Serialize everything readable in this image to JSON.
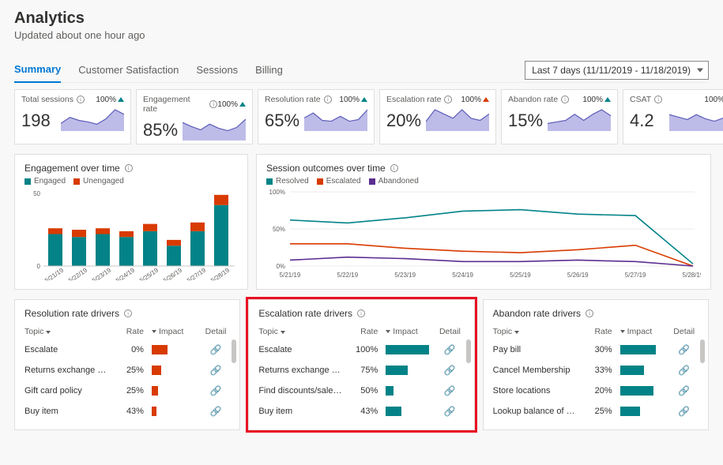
{
  "header": {
    "title": "Analytics",
    "subtitle": "Updated about one hour ago"
  },
  "tabs": [
    "Summary",
    "Customer Satisfaction",
    "Sessions",
    "Billing"
  ],
  "date_range": "Last 7 days (11/11/2019 - 11/18/2019)",
  "kpis": [
    {
      "label": "Total sessions",
      "value": "198",
      "pct": "100%",
      "trend": "up",
      "trend_color": "teal"
    },
    {
      "label": "Engagement rate",
      "value": "85%",
      "pct": "100%",
      "trend": "up",
      "trend_color": "teal"
    },
    {
      "label": "Resolution rate",
      "value": "65%",
      "pct": "100%",
      "trend": "up",
      "trend_color": "teal"
    },
    {
      "label": "Escalation rate",
      "value": "20%",
      "pct": "100%",
      "trend": "up",
      "trend_color": "orange"
    },
    {
      "label": "Abandon rate",
      "value": "15%",
      "pct": "100%",
      "trend": "up",
      "trend_color": "teal"
    },
    {
      "label": "CSAT",
      "value": "4.2",
      "pct": "100%",
      "trend": "up",
      "trend_color": "teal"
    }
  ],
  "engagement_card": {
    "title": "Engagement over time",
    "legend": [
      {
        "label": "Engaged",
        "color": "#038387"
      },
      {
        "label": "Unengaged",
        "color": "#d83b01"
      }
    ]
  },
  "outcomes_card": {
    "title": "Session outcomes over time",
    "legend": [
      {
        "label": "Resolved",
        "color": "#038387"
      },
      {
        "label": "Escalated",
        "color": "#d83b01"
      },
      {
        "label": "Abandoned",
        "color": "#5c2d91"
      }
    ]
  },
  "driver_cards": [
    {
      "title": "Resolution rate drivers",
      "head": {
        "topic": "Topic",
        "rate": "Rate",
        "impact": "Impact",
        "detail": "Detail"
      },
      "rows": [
        {
          "topic": "Escalate",
          "rate": "0%",
          "impact": 20,
          "color": "#d83b01"
        },
        {
          "topic": "Returns exchange and re...",
          "rate": "25%",
          "impact": 12,
          "color": "#d83b01"
        },
        {
          "topic": "Gift card policy",
          "rate": "25%",
          "impact": 8,
          "color": "#d83b01"
        },
        {
          "topic": "Buy item",
          "rate": "43%",
          "impact": 6,
          "color": "#d83b01"
        }
      ]
    },
    {
      "title": "Escalation rate drivers",
      "head": {
        "topic": "Topic",
        "rate": "Rate",
        "impact": "Impact",
        "detail": "Detail"
      },
      "rows": [
        {
          "topic": "Escalate",
          "rate": "100%",
          "impact": 55,
          "color": "#038387"
        },
        {
          "topic": "Returns exchange and r...",
          "rate": "75%",
          "impact": 28,
          "color": "#038387"
        },
        {
          "topic": "Find discounts/sales/de...",
          "rate": "50%",
          "impact": 10,
          "color": "#038387"
        },
        {
          "topic": "Buy item",
          "rate": "43%",
          "impact": 20,
          "color": "#038387"
        }
      ]
    },
    {
      "title": "Abandon rate drivers",
      "head": {
        "topic": "Topic",
        "rate": "Rate",
        "impact": "Impact",
        "detail": "Detail"
      },
      "rows": [
        {
          "topic": "Pay bill",
          "rate": "30%",
          "impact": 45,
          "color": "#038387"
        },
        {
          "topic": "Cancel Membership",
          "rate": "33%",
          "impact": 30,
          "color": "#038387"
        },
        {
          "topic": "Store locations",
          "rate": "20%",
          "impact": 42,
          "color": "#038387"
        },
        {
          "topic": "Lookup balance of gift...",
          "rate": "25%",
          "impact": 25,
          "color": "#038387"
        }
      ]
    }
  ],
  "chart_data": [
    {
      "type": "area",
      "id": "kpi_sparklines",
      "note": "approximate relative values for 6 KPI sparklines",
      "series": [
        {
          "name": "Total sessions",
          "values": [
            10,
            18,
            14,
            12,
            9,
            16,
            28,
            22
          ]
        },
        {
          "name": "Engagement rate",
          "values": [
            22,
            17,
            13,
            20,
            15,
            12,
            16,
            26
          ]
        },
        {
          "name": "Resolution rate",
          "values": [
            16,
            22,
            13,
            12,
            18,
            12,
            14,
            26
          ]
        },
        {
          "name": "Escalation rate",
          "values": [
            9,
            20,
            16,
            12,
            20,
            12,
            10,
            16
          ]
        },
        {
          "name": "Abandon rate",
          "values": [
            10,
            12,
            14,
            22,
            14,
            22,
            28,
            20
          ]
        },
        {
          "name": "CSAT",
          "values": [
            20,
            17,
            14,
            20,
            15,
            12,
            16,
            26
          ]
        }
      ]
    },
    {
      "type": "bar",
      "id": "engagement_over_time",
      "title": "Engagement over time",
      "categories": [
        "5/21/19",
        "5/22/19",
        "5/23/19",
        "5/24/19",
        "5/25/19",
        "5/26/19",
        "5/27/19",
        "5/28/19"
      ],
      "ylim": [
        0,
        50
      ],
      "series": [
        {
          "name": "Engaged",
          "color": "#038387",
          "values": [
            22,
            20,
            22,
            20,
            24,
            14,
            24,
            42
          ]
        },
        {
          "name": "Unengaged",
          "color": "#d83b01",
          "values": [
            4,
            5,
            4,
            4,
            5,
            4,
            6,
            7
          ]
        }
      ]
    },
    {
      "type": "line",
      "id": "session_outcomes_over_time",
      "title": "Session outcomes over time",
      "categories": [
        "5/21/19",
        "5/22/19",
        "5/23/19",
        "5/24/19",
        "5/25/19",
        "5/26/19",
        "5/27/19",
        "5/28/19"
      ],
      "ylabel": "%",
      "ylim": [
        0,
        100
      ],
      "series": [
        {
          "name": "Resolved",
          "color": "#038387",
          "values": [
            62,
            58,
            65,
            74,
            76,
            70,
            68,
            3
          ]
        },
        {
          "name": "Escalated",
          "color": "#d83b01",
          "values": [
            30,
            30,
            24,
            20,
            18,
            22,
            28,
            0
          ]
        },
        {
          "name": "Abandoned",
          "color": "#5c2d91",
          "values": [
            8,
            12,
            10,
            6,
            6,
            8,
            6,
            0
          ]
        }
      ]
    }
  ]
}
